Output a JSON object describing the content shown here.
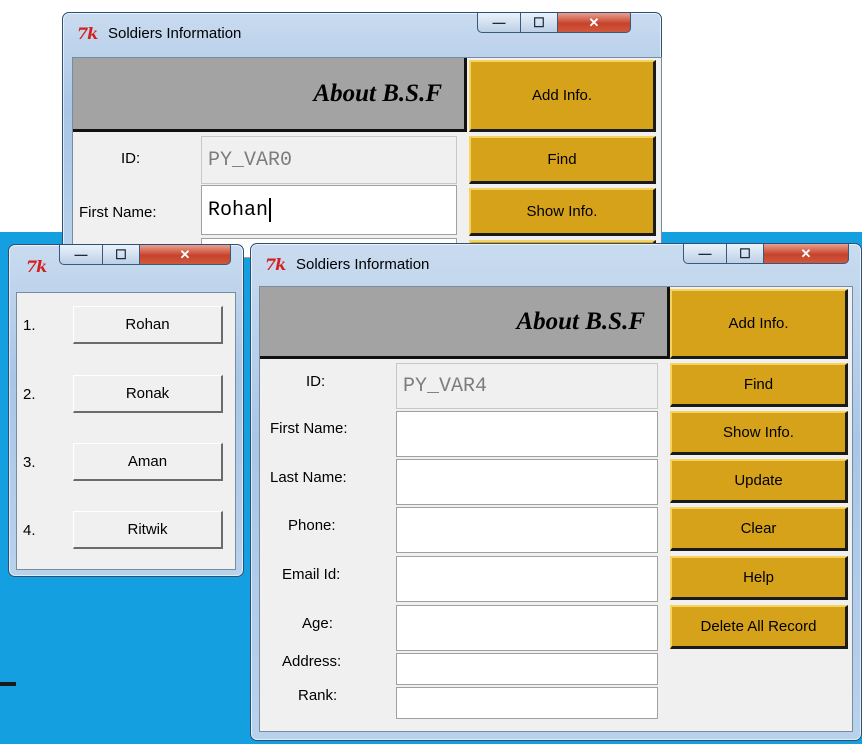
{
  "back_window": {
    "title": "Soldiers Information",
    "header": "About B.S.F",
    "buttons": {
      "add": "Add Info.",
      "find": "Find",
      "show": "Show Info."
    },
    "labels": {
      "id": "ID:",
      "first_name": "First Name:"
    },
    "fields": {
      "id": "PY_VAR0",
      "first_name": "Rohan"
    }
  },
  "list_window": {
    "items": [
      {
        "num": "1.",
        "name": "Rohan"
      },
      {
        "num": "2.",
        "name": "Ronak"
      },
      {
        "num": "3.",
        "name": "Aman"
      },
      {
        "num": "4.",
        "name": "Ritwik"
      }
    ]
  },
  "front_window": {
    "title": "Soldiers Information",
    "header": "About B.S.F",
    "labels": {
      "id": "ID:",
      "first_name": "First Name:",
      "last_name": "Last Name:",
      "phone": "Phone:",
      "email": "Email Id:",
      "age": "Age:",
      "address": "Address:",
      "rank": "Rank:"
    },
    "fields": {
      "id": "PY_VAR4"
    },
    "buttons": {
      "add": "Add Info.",
      "find": "Find",
      "show": "Show Info.",
      "update": "Update",
      "clear": "Clear",
      "help": "Help",
      "delete_all": "Delete All Record"
    }
  },
  "window_controls": {
    "minimize": "—",
    "maximize": "☐",
    "close": "✕"
  },
  "colors": {
    "desktop": "#149fe0",
    "button_gold": "#d6a21a",
    "header_gray": "#a3a3a3"
  }
}
